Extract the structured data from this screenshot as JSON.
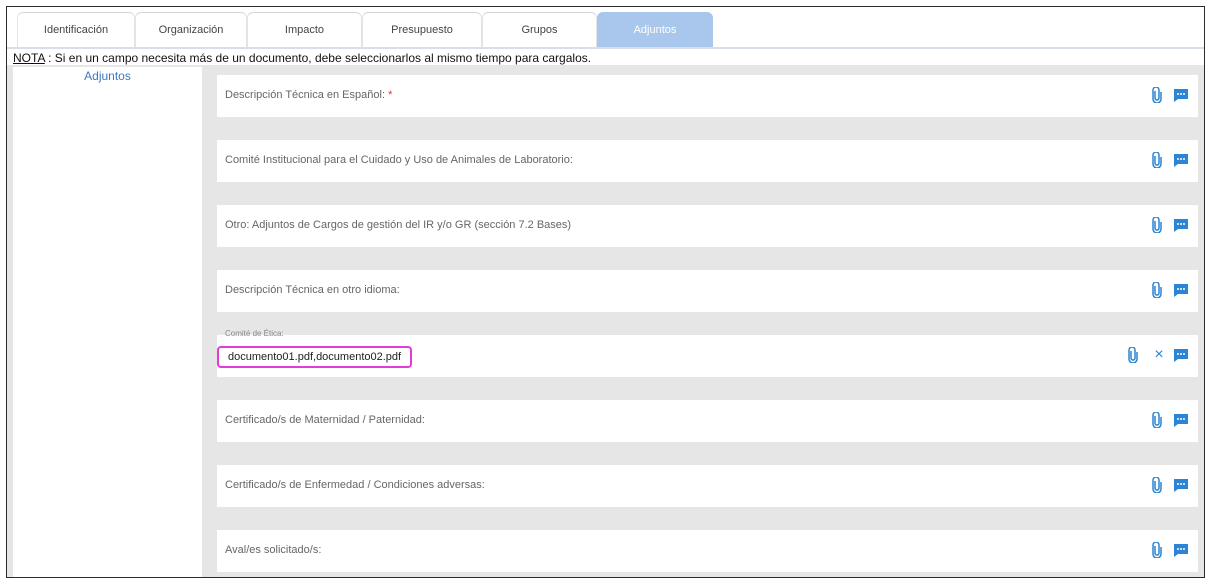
{
  "tabs": [
    {
      "label": "Identificación",
      "active": false
    },
    {
      "label": "Organización",
      "active": false
    },
    {
      "label": "Impacto",
      "active": false
    },
    {
      "label": "Presupuesto",
      "active": false
    },
    {
      "label": "Grupos",
      "active": false
    },
    {
      "label": "Adjuntos",
      "active": true
    }
  ],
  "nota": {
    "prefix": "NOTA",
    "text": " : Si en un campo necesita más de un documento, debe seleccionarlos al mismo tiempo para cargalos."
  },
  "sidebar": {
    "link": "Adjuntos"
  },
  "fields": [
    {
      "label": "Descripción Técnica en Español:",
      "required_mark": "*"
    },
    {
      "label": "Comité Institucional para el Cuidado y Uso de Animales de Laboratorio:"
    },
    {
      "label": "Otro: Adjuntos de Cargos de gestión del IR y/o GR (sección 7.2 Bases)"
    },
    {
      "label": "Descripción Técnica en otro idioma:"
    },
    {
      "label": "Comité de Ética:",
      "value": "documento01.pdf,documento02.pdf"
    },
    {
      "label": "Certificado/s de Maternidad / Paternidad:"
    },
    {
      "label": "Certificado/s de Enfermedad / Condiciones adversas:"
    },
    {
      "label": "Aval/es solicitado/s:"
    }
  ],
  "icons": {
    "attach": "paperclip-icon",
    "comment": "comment-icon",
    "remove": "close-icon",
    "remove_glyph": "×"
  },
  "colors": {
    "accent": "#2b84d4",
    "active_tab": "#a9c6ec",
    "required": "#e0303a",
    "highlight": "#e23bd8"
  }
}
